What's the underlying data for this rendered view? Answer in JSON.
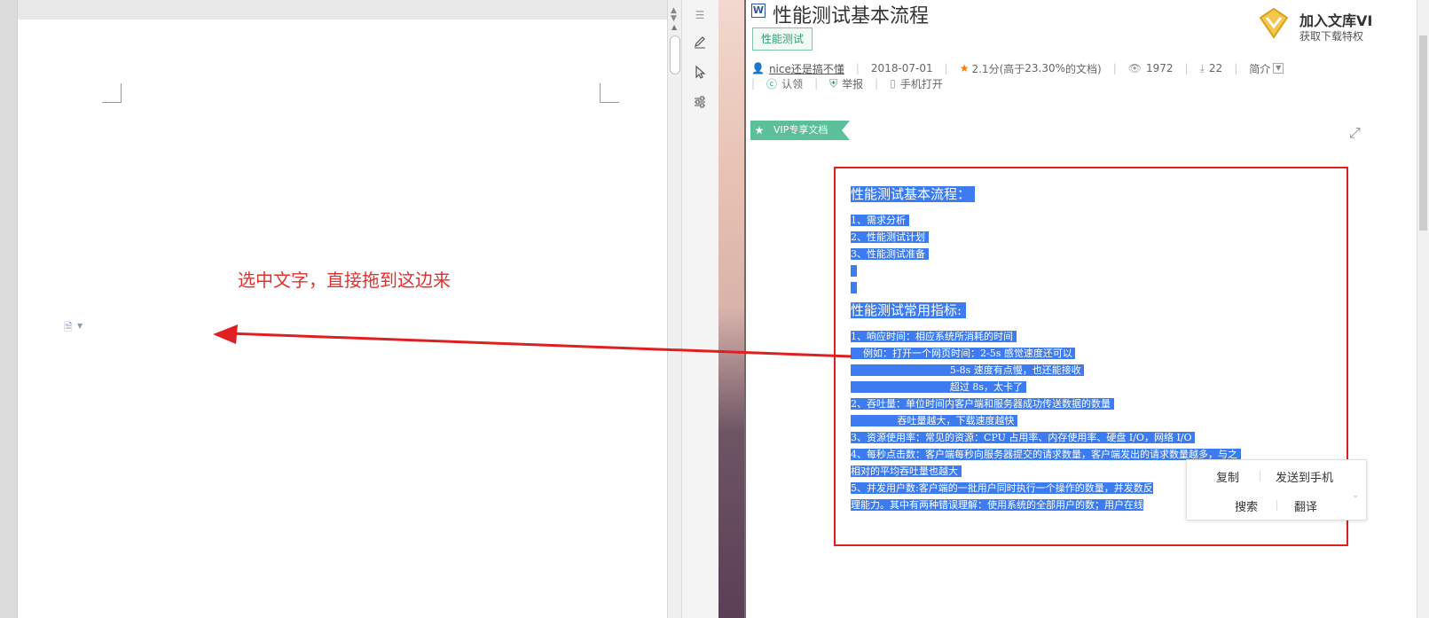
{
  "word_editor": {
    "hint_text": "选中文字，直接拖到这边来",
    "tools": {
      "menu_icon": "hamburger-icon",
      "pen_icon": "pen-icon",
      "select_icon": "cursor-icon",
      "settings_icon": "sliders-icon"
    }
  },
  "doc_page": {
    "title": "性能测试基本流程",
    "tag": "性能测试",
    "vip_join_title": "加入文库VI",
    "vip_join_sub": "获取下载特权",
    "author": "nice还是搞不懂",
    "date": "2018-07-01",
    "rating": "2.1分(高于",
    "rating_pct": "23.30%",
    "rating_tail": "的文档)",
    "views": "1972",
    "downloads": "22",
    "intro": "简介",
    "claim": "认领",
    "report": "举报",
    "mobile_open": "手机打开",
    "vip_ribbon": "VIP专享文档"
  },
  "content_lines": [
    {
      "text": "性能测试基本流程： ",
      "kind": "heading"
    },
    {
      "text": "1、需求分析 ",
      "kind": "line"
    },
    {
      "text": "2、性能测试计划 ",
      "kind": "line"
    },
    {
      "text": "3、性能测试准备 ",
      "kind": "line"
    },
    {
      "text": "  ",
      "kind": "line"
    },
    {
      "text": "  ",
      "kind": "line"
    },
    {
      "text": "性能测试常用指标: ",
      "kind": "heading"
    },
    {
      "text": "1、响应时间：相应系统所消耗的时间 ",
      "kind": "line"
    },
    {
      "text": "    例如：打开一个网页时间：2-5s 感觉速度还可以 ",
      "kind": "line"
    },
    {
      "text": "                                5-8s 速度有点慢，也还能接收 ",
      "kind": "line"
    },
    {
      "text": "                                超过 8s，太卡了 ",
      "kind": "line"
    },
    {
      "text": "2、吞吐量：单位时间内客户端和服务器成功传送数据的数量 ",
      "kind": "line"
    },
    {
      "text": "               吞吐量越大，下载速度越快 ",
      "kind": "line"
    },
    {
      "text": "3、资源使用率：常见的资源：CPU 占用率、内存使用率、硬盘 I/O，网络 I/O ",
      "kind": "line"
    },
    {
      "text": "4、每秒点击数：客户端每秒向服务器提交的请求数量，客户端发出的请求数量越多，与之 ",
      "kind": "line"
    },
    {
      "text": "相对的平均吞吐量也越大 ",
      "kind": "line"
    },
    {
      "text": "5、并发用户数:客户端的一批用户同时执行一个操作的数量，并发数反",
      "kind": "line"
    },
    {
      "text": "理能力。其中有两种错误理解：使用系统的全部用户的数；用户在线",
      "kind": "line"
    }
  ],
  "context_menu": {
    "copy": "复制",
    "send_to_phone": "发送到手机",
    "search": "搜索",
    "translate": "翻译"
  },
  "colors": {
    "highlight": "#3d7cf0",
    "annotation_red": "#e02020",
    "vip_green": "#5bbf9a"
  }
}
